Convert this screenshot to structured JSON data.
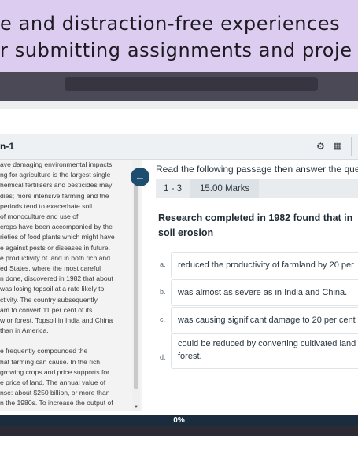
{
  "banner": {
    "line1": "e and distraction-free experiences",
    "line2": "r submitting assignments and proje"
  },
  "app": {
    "title": "n-1",
    "icons": {
      "settings": "gear-icon",
      "menu": "grid-icon",
      "collapse": "arrow-left-icon"
    }
  },
  "passage": {
    "para1": [
      "ave damaging environmental impacts.",
      "ng for agriculture is the largest single",
      "hemical fertilisers and pesticides may",
      "dies; more intensive farming and the",
      "periods tend to exacerbate soil",
      "of monoculture and use of",
      "crops have been accompanied by the",
      "rieties of food plants which might have",
      "e against pests or diseases in future.",
      "e productivity of land in both rich and",
      "ed States, where the most careful",
      "n done, discovered in 1982 that about",
      "was losing topsoil at a rate likely to",
      "ctivity. The country subsequently",
      "am to convert 11 per cent of its",
      "w or forest. Topsoil in India and China",
      "than in America."
    ],
    "para2": [
      "e frequently compounded the",
      "hat farming can cause. In the rich",
      "growing crops and price supports for",
      "e price of land. The annual value of",
      "nse: about $250 billion, or more than",
      "n the 1980s. To increase the output of"
    ]
  },
  "question": {
    "instruction": "Read the following passage then answer the que",
    "range": "1 - 3",
    "marks": "15.00 Marks",
    "stem_line1": "Research completed in 1982 found that in",
    "stem_line2": "soil erosion",
    "options": [
      {
        "letter": "a.",
        "line1": "reduced the productivity of farmland by 20 per",
        "line2": ""
      },
      {
        "letter": "b.",
        "line1": "was almost as severe as in India and China.",
        "line2": ""
      },
      {
        "letter": "c.",
        "line1": "was causing significant damage to 20 per cent o",
        "line2": ""
      },
      {
        "letter": "d.",
        "line1": "could be reduced by converting cultivated land",
        "line2": "forest."
      }
    ]
  },
  "progress": {
    "label": "0%",
    "value": 0
  }
}
